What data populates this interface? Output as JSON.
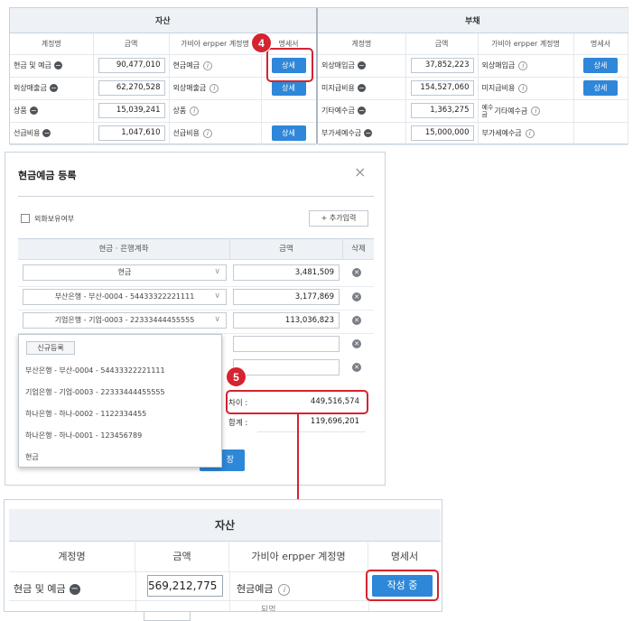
{
  "top_table": {
    "assets": {
      "section_title": "자산",
      "columns": [
        "계정명",
        "금액",
        "가비아 erpper 계정명",
        "명세서"
      ],
      "rows": [
        {
          "name": "현금 및 예금",
          "amount": "90,477,010",
          "erp_name": "현금예금",
          "button": "상세"
        },
        {
          "name": "외상매출금",
          "amount": "62,270,528",
          "erp_name": "외상매출금",
          "button": "상세"
        },
        {
          "name": "상품",
          "amount": "15,039,241",
          "erp_name": "상품",
          "button": ""
        },
        {
          "name": "선급비용",
          "amount": "1,047,610",
          "erp_name": "선급비용",
          "button": "상세"
        }
      ]
    },
    "liabilities": {
      "section_title": "부채",
      "columns": [
        "계정명",
        "금액",
        "가비아 erpper 계정명",
        "명세서"
      ],
      "rows": [
        {
          "name": "외상매입금",
          "amount": "37,852,223",
          "erp_name": "외상매입금",
          "button": "상세"
        },
        {
          "name": "미지급비용",
          "amount": "154,527,060",
          "erp_name": "미지급비용",
          "button": "상세"
        },
        {
          "name": "기타예수금",
          "amount": "1,363,275",
          "erp_name": "기타예수금",
          "erp_prefix": "예수\n금",
          "button": ""
        },
        {
          "name": "부가세예수금",
          "amount": "15,000,000",
          "erp_name": "부가세예수금",
          "button": ""
        }
      ]
    }
  },
  "modal": {
    "title": "현금예금 등록",
    "close_icon": "×",
    "foreign_currency_label": "외화보유여부",
    "add_button": "+ 추가입력",
    "columns": {
      "account": "현금 · 은행계좌",
      "amount": "금액",
      "delete": "삭제"
    },
    "rows": [
      {
        "account": "현금",
        "amount": "3,481,509"
      },
      {
        "account": "부산은행 - 부산-0004 - 54433322221111",
        "amount": "3,177,869"
      },
      {
        "account": "기업은행 - 기업-0003 - 22333444455555",
        "amount": "113,036,823"
      },
      {
        "account": "",
        "amount": ""
      },
      {
        "account": "",
        "amount": ""
      }
    ],
    "dropdown": {
      "new_button": "신규등록",
      "options": [
        "부산은행 - 부산-0004 - 54433322221111",
        "기업은행 - 기업-0003 - 22333444455555",
        "하나은행 - 하나-0002 - 1122334455",
        "하나은행 - 하나-0001 - 123456789",
        "현금"
      ]
    },
    "difference_label": "차이 :",
    "difference_value": "449,516,574",
    "total_label": "합계 :",
    "total_value": "119,696,201",
    "save_button_partial": "장"
  },
  "zoom_panel": {
    "section_title": "자산",
    "columns": [
      "계정명",
      "금액",
      "가비아 erpper 계정명",
      "명세서"
    ],
    "row": {
      "name": "현금 및 예금",
      "amount": "569,212,775",
      "erp_name": "현금예금",
      "button": "작성 중"
    },
    "cut_text": "되먹"
  },
  "annotations": {
    "step4": "4",
    "step5": "5"
  },
  "colors": {
    "accent": "#2e87d8",
    "annotation": "#d5232f",
    "header_bg": "#eef2f6"
  }
}
